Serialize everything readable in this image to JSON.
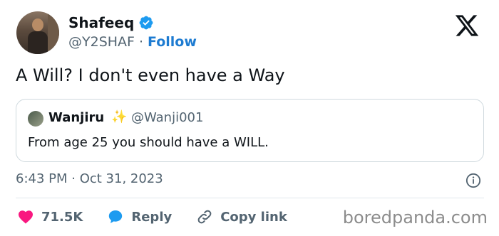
{
  "author": {
    "display_name": "Shafeeq",
    "handle": "@Y2SHAF",
    "separator": "·",
    "follow_label": "Follow"
  },
  "tweet": {
    "text": "A Will? I don't even have a Way"
  },
  "quoted": {
    "display_name": "Wanjiru",
    "sparkle": "✨",
    "handle": "@Wanji001",
    "text": "From age 25 you should have a WILL."
  },
  "meta": {
    "timestamp": "6:43 PM · Oct 31, 2023"
  },
  "actions": {
    "like_count": "71.5K",
    "reply_label": "Reply",
    "copy_link_label": "Copy link"
  },
  "watermark": "boredpanda.com",
  "colors": {
    "accent": "#1d9bf0",
    "like": "#f91880",
    "muted": "#536471"
  }
}
